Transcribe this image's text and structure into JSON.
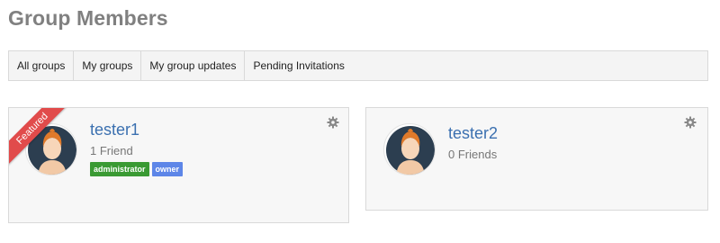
{
  "page": {
    "title": "Group Members"
  },
  "tabs": [
    {
      "label": "All groups"
    },
    {
      "label": "My groups"
    },
    {
      "label": "My group updates"
    },
    {
      "label": "Pending Invitations"
    }
  ],
  "members": [
    {
      "name": "tester1",
      "friends": "1 Friend",
      "ribbon": "Featured",
      "badges": [
        {
          "label": "administrator",
          "color": "#3a9a33"
        },
        {
          "label": "owner",
          "color": "#5d86e8"
        }
      ]
    },
    {
      "name": "tester2",
      "friends": "0 Friends"
    }
  ],
  "icons": {
    "settings": "gear-icon",
    "avatar": "avatar-icon"
  },
  "colors": {
    "link": "#3b70b0",
    "ribbon": "#e14b4b",
    "title": "#808080"
  }
}
